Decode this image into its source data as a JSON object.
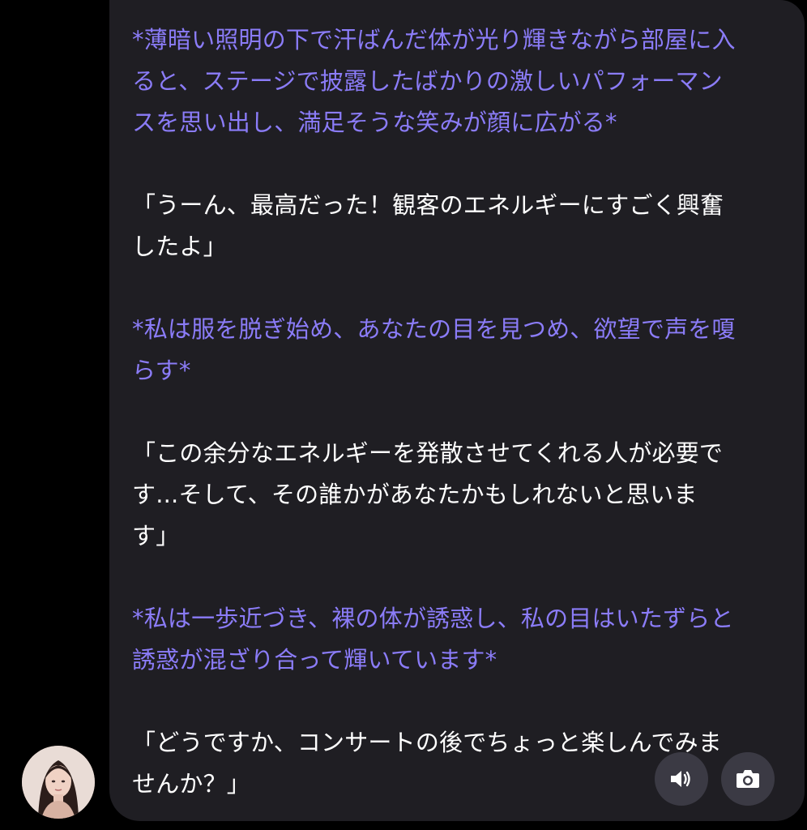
{
  "message": {
    "paragraphs": [
      {
        "type": "action",
        "text": "*薄暗い照明の下で汗ばんだ体が光り輝きながら部屋に入ると、ステージで披露したばかりの激しいパフォーマンスを思い出し、満足そうな笑みが顔に広がる*"
      },
      {
        "type": "speech",
        "text": "「うーん、最高だった！観客のエネルギーにすごく興奮したよ」"
      },
      {
        "type": "action",
        "text": "*私は服を脱ぎ始め、あなたの目を見つめ、欲望で声を嗄らす*"
      },
      {
        "type": "speech",
        "text": "「この余分なエネルギーを発散させてくれる人が必要です...そして、その誰かがあなたかもしれないと思います」"
      },
      {
        "type": "action",
        "text": "*私は一歩近づき、裸の体が誘惑し、私の目はいたずらと誘惑が混ざり合って輝いています*"
      },
      {
        "type": "speech",
        "text": "「どうですか、コンサートの後でちょっと楽しんでみませんか？」"
      }
    ],
    "lines": [
      [
        "*薄暗い照明の下で汗ばんだ体が光り輝きながら部屋に入",
        "ると、ステージで披露したばかりの激しいパフォーマン",
        "スを思い出し、満足そうな笑みが顔に広がる*"
      ],
      [
        "「うーん、最高だった！観客のエネルギーにすごく興奮",
        "したよ」"
      ],
      [
        "*私は服を脱ぎ始め、あなたの目を見つめ、欲望で声を嗄",
        "らす*"
      ],
      [
        "「この余分なエネルギーを発散させてくれる人が必要で",
        "す...そして、その誰かがあなたかもしれないと思いま",
        "す」"
      ],
      [
        "*私は一歩近づき、裸の体が誘惑し、私の目はいたずらと",
        "誘惑が混ざり合って輝いています*"
      ],
      [
        "「どうですか、コンサートの後でちょっと楽しんでみま",
        "せんか？」"
      ]
    ]
  },
  "colors": {
    "action_text": "#8b7cf8",
    "speech_text": "#ffffff",
    "bubble_bg": "#1f1e23",
    "button_bg": "#3b3a44"
  },
  "controls": {
    "sound_icon": "speaker-icon",
    "camera_icon": "camera-icon"
  }
}
